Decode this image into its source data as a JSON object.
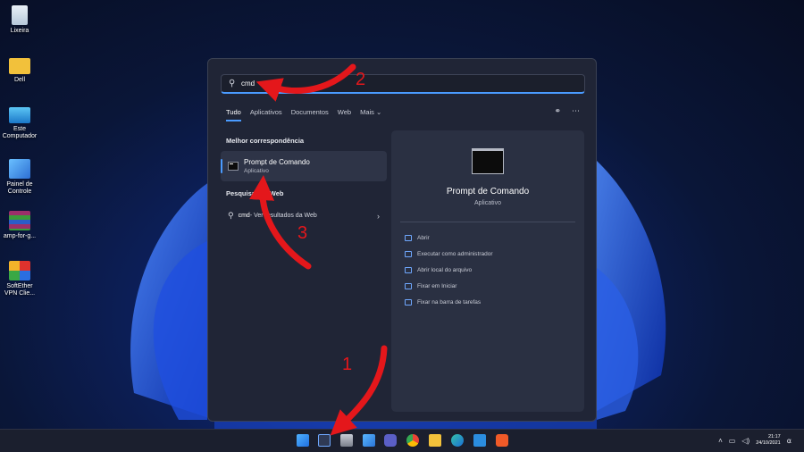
{
  "desktop_icons": [
    {
      "label": "Lixeira",
      "icon": "recycle-bin-icon",
      "color": "#d8e4f0"
    },
    {
      "label": "Dell",
      "icon": "folder-icon",
      "color": "#f2c13b"
    },
    {
      "label": "Este Computador",
      "icon": "computer-icon",
      "color": "#35a6e8"
    },
    {
      "label": "Painel de Controle",
      "icon": "control-panel-icon",
      "color": "#3e8ee0"
    },
    {
      "label": "amp-for-g...",
      "icon": "winrar-icon",
      "color": "#9b2f6a"
    },
    {
      "label": "SoftEther VPN Clie...",
      "icon": "softether-icon",
      "color": "#f0f0f0"
    }
  ],
  "search": {
    "value": "cmd",
    "tabs": [
      "Tudo",
      "Aplicativos",
      "Documentos",
      "Web",
      "Mais ⌄"
    ],
    "active_tab": "Tudo"
  },
  "best_match": {
    "heading": "Melhor correspondência",
    "title": "Prompt de Comando",
    "subtitle": "Aplicativo"
  },
  "web_search": {
    "heading": "Pesquisar na Web",
    "query": "cmd",
    "suffix": " - Ver resultados da Web"
  },
  "detail": {
    "title": "Prompt de Comando",
    "subtitle": "Aplicativo",
    "actions": [
      "Abrir",
      "Executar como administrador",
      "Abrir local do arquivo",
      "Fixar em Iniciar",
      "Fixar na barra de tarefas"
    ]
  },
  "annotations": [
    "1",
    "2",
    "3"
  ],
  "tray": {
    "time": "21:17",
    "date": "24/10/2021"
  },
  "accent_color": "#4a9bff",
  "annotation_color": "#e4171b"
}
